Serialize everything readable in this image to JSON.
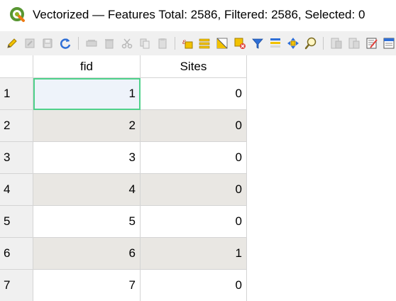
{
  "window": {
    "title": "Vectorized — Features Total: 2586, Filtered: 2586, Selected: 0",
    "app_icon": "qgis-logo-icon"
  },
  "toolbar": {
    "buttons": [
      {
        "name": "toggle-editing-icon",
        "enabled": true
      },
      {
        "name": "multi-edit-icon",
        "enabled": false
      },
      {
        "name": "save-edits-icon",
        "enabled": false
      },
      {
        "name": "reload-table-icon",
        "enabled": true
      },
      {
        "name": "add-feature-icon",
        "enabled": false
      },
      {
        "name": "delete-feature-icon",
        "enabled": false
      },
      {
        "name": "cut-icon",
        "enabled": false
      },
      {
        "name": "copy-icon",
        "enabled": false
      },
      {
        "name": "paste-icon",
        "enabled": false
      },
      {
        "name": "select-by-expression-icon",
        "enabled": true
      },
      {
        "name": "select-all-icon",
        "enabled": true
      },
      {
        "name": "invert-selection-icon",
        "enabled": true
      },
      {
        "name": "deselect-all-icon",
        "enabled": true
      },
      {
        "name": "filter-select-icon",
        "enabled": true
      },
      {
        "name": "move-selection-top-icon",
        "enabled": true
      },
      {
        "name": "pan-to-selection-icon",
        "enabled": true
      },
      {
        "name": "zoom-to-selection-icon",
        "enabled": true
      },
      {
        "name": "new-field-icon",
        "enabled": false
      },
      {
        "name": "delete-field-icon",
        "enabled": false
      },
      {
        "name": "field-calculator-icon",
        "enabled": true
      },
      {
        "name": "conditional-formatting-icon",
        "enabled": true
      }
    ],
    "colors": {
      "accent_yellow": "#f2c200",
      "accent_blue": "#2f6fd6",
      "accent_red": "#e0403a",
      "disabled_gray": "#b8b8b8"
    }
  },
  "table": {
    "columns": [
      "fid",
      "Sites"
    ],
    "rows": [
      {
        "header": "1",
        "fid": "1",
        "sites": "0"
      },
      {
        "header": "2",
        "fid": "2",
        "sites": "0"
      },
      {
        "header": "3",
        "fid": "3",
        "sites": "0"
      },
      {
        "header": "4",
        "fid": "4",
        "sites": "0"
      },
      {
        "header": "5",
        "fid": "5",
        "sites": "0"
      },
      {
        "header": "6",
        "fid": "6",
        "sites": "1"
      },
      {
        "header": "7",
        "fid": "7",
        "sites": "0"
      }
    ],
    "current_cell_color": "#4fd18b",
    "alt_row_color": "#e9e7e3"
  }
}
